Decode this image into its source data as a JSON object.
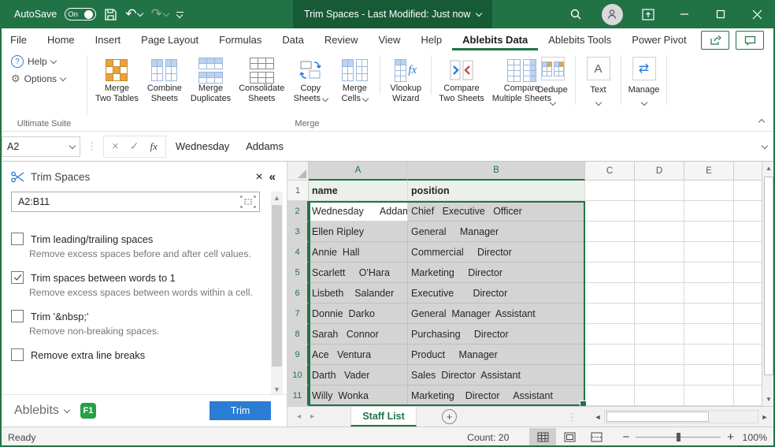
{
  "colors": {
    "accent_green": "#217346",
    "panel_blue": "#2b7cd3",
    "badge_green": "#24a148",
    "selection_gray": "#d4d4d4"
  },
  "icons": {
    "undo": "↶",
    "redo": "↷",
    "close": "×",
    "collapse": "«",
    "dots": "⋮",
    "fx": "fx",
    "swap": "⇄",
    "nav_left": "◂",
    "nav_right": "▸",
    "tri_up": "▲",
    "tri_down": "▼",
    "tri_left": "◄",
    "tri_right": "►",
    "minus": "−",
    "plus": "+",
    "question": "?",
    "gear": "⚙",
    "letterA": "A",
    "caret_small": "▾"
  },
  "titlebar": {
    "autosave": "AutoSave",
    "autosave_state": "On",
    "doc_title": "Trim Spaces  -  Last Modified: Just now"
  },
  "tabs": {
    "items": [
      "File",
      "Home",
      "Insert",
      "Page Layout",
      "Formulas",
      "Data",
      "Review",
      "View",
      "Help",
      "Ablebits Data",
      "Ablebits Tools",
      "Power Pivot"
    ],
    "active": "Ablebits Data"
  },
  "ribbon": {
    "help_label": "Help",
    "options_label": "Options",
    "group_ultimate": "Ultimate Suite",
    "group_merge": "Merge",
    "merge_buttons": [
      {
        "l1": "Merge",
        "l2": "Two Tables"
      },
      {
        "l1": "Combine",
        "l2": "Sheets"
      },
      {
        "l1": "Merge",
        "l2": "Duplicates"
      },
      {
        "l1": "Consolidate",
        "l2": "Sheets"
      },
      {
        "l1": "Copy",
        "l2": "Sheets"
      },
      {
        "l1": "Merge",
        "l2": "Cells"
      },
      {
        "l1": "Vlookup",
        "l2": "Wizard"
      },
      {
        "l1": "Compare",
        "l2": "Two Sheets"
      },
      {
        "l1": "Compare",
        "l2": "Multiple Sheets"
      }
    ],
    "tools": [
      {
        "label": "Dedupe"
      },
      {
        "label": "Text"
      },
      {
        "label": "Manage"
      }
    ]
  },
  "formula_bar": {
    "name_box": "A2",
    "value": "Wednesday      Addams"
  },
  "panel": {
    "title": "Trim Spaces",
    "range": "A2:B11",
    "options": [
      {
        "label": "Trim leading/trailing spaces",
        "desc": "Remove excess spaces before and after cell values.",
        "checked": false
      },
      {
        "label": "Trim spaces between words to 1",
        "desc": "Remove excess spaces between words within a cell.",
        "checked": true
      },
      {
        "label": "Trim '&nbsp;'",
        "desc": "Remove non-breaking spaces.",
        "checked": false
      },
      {
        "label": "Remove extra line breaks",
        "desc": "",
        "checked": false
      }
    ],
    "brand": "Ablebits",
    "badge": "F1",
    "trim_button": "Trim"
  },
  "grid": {
    "columns": [
      "A",
      "B",
      "C",
      "D",
      "E"
    ],
    "header": {
      "num": "1",
      "name": "name",
      "position": "position"
    },
    "rows": [
      {
        "num": "2",
        "name": "Wednesday      Addams",
        "position": "Chief   Executive   Officer"
      },
      {
        "num": "3",
        "name": "Ellen Ripley",
        "position": "General     Manager"
      },
      {
        "num": "4",
        "name": "Annie  Hall",
        "position": "Commercial     Director"
      },
      {
        "num": "5",
        "name": "Scarlett     O'Hara",
        "position": "Marketing     Director"
      },
      {
        "num": "6",
        "name": "Lisbeth    Salander",
        "position": "Executive       Director"
      },
      {
        "num": "7",
        "name": "Donnie  Darko",
        "position": "General  Manager  Assistant"
      },
      {
        "num": "8",
        "name": "Sarah   Connor",
        "position": "Purchasing     Director"
      },
      {
        "num": "9",
        "name": "Ace   Ventura",
        "position": "Product     Manager"
      },
      {
        "num": "10",
        "name": "Darth   Vader",
        "position": "Sales  Director  Assistant"
      },
      {
        "num": "11",
        "name": "Willy  Wonka",
        "position": "Marketing    Director     Assistant"
      }
    ]
  },
  "sheet_tabs": {
    "active": "Staff List"
  },
  "status_bar": {
    "ready": "Ready",
    "count": "Count: 20",
    "zoom_level": "100%"
  }
}
